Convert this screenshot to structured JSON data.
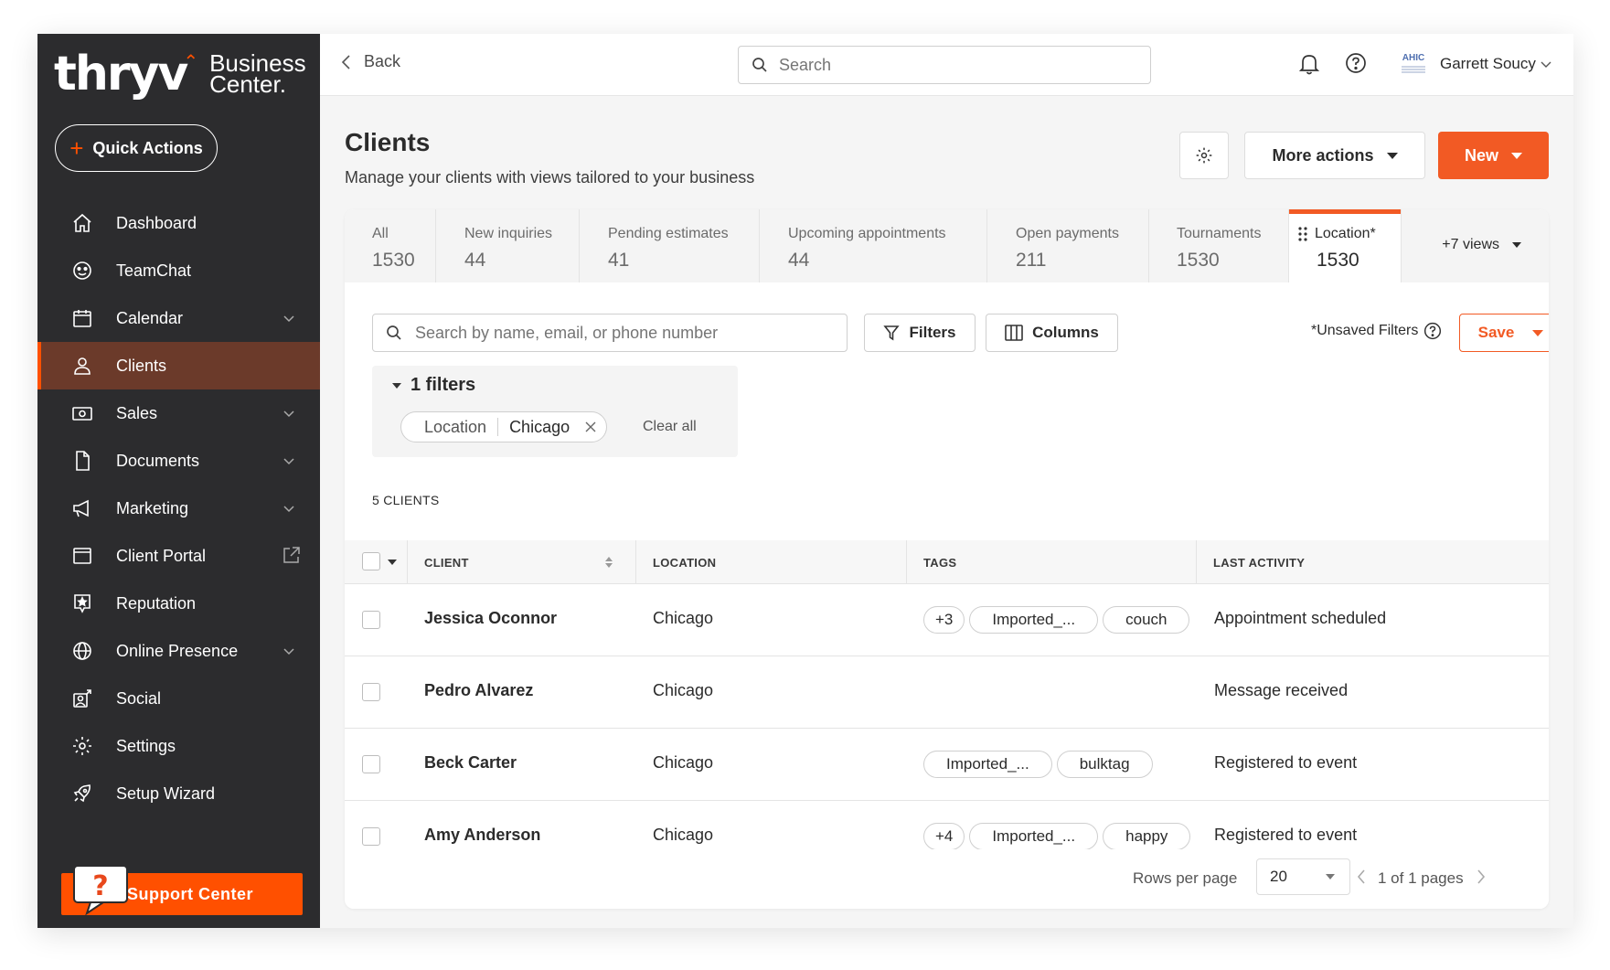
{
  "brand": {
    "logo_main": "thryv",
    "logo_sub_line1": "Business",
    "logo_sub_line2": "Center.",
    "accent": "#ff5000"
  },
  "sidebar": {
    "quick_actions": "Quick Actions",
    "items": [
      {
        "label": "Dashboard",
        "icon": "home-icon",
        "caret": false
      },
      {
        "label": "TeamChat",
        "icon": "chat-icon",
        "caret": false
      },
      {
        "label": "Calendar",
        "icon": "calendar-icon",
        "caret": true
      },
      {
        "label": "Clients",
        "icon": "person-icon",
        "caret": false,
        "active": true
      },
      {
        "label": "Sales",
        "icon": "money-icon",
        "caret": true
      },
      {
        "label": "Documents",
        "icon": "document-icon",
        "caret": true
      },
      {
        "label": "Marketing",
        "icon": "megaphone-icon",
        "caret": true
      },
      {
        "label": "Client Portal",
        "icon": "browser-icon",
        "caret": false,
        "external": true
      },
      {
        "label": "Reputation",
        "icon": "star-badge-icon",
        "caret": false
      },
      {
        "label": "Online Presence",
        "icon": "globe-icon",
        "caret": true
      },
      {
        "label": "Social",
        "icon": "social-icon",
        "caret": false
      },
      {
        "label": "Settings",
        "icon": "gear-icon",
        "caret": false
      },
      {
        "label": "Setup Wizard",
        "icon": "rocket-icon",
        "caret": false
      }
    ],
    "support": "Support Center"
  },
  "topbar": {
    "back": "Back",
    "search_placeholder": "Search",
    "avatar_text": "AHIC",
    "user_name": "Garrett Soucy"
  },
  "page": {
    "title": "Clients",
    "subtitle": "Manage your clients with views tailored to your business",
    "more_actions": "More actions",
    "new": "New"
  },
  "tabs": [
    {
      "label": "All",
      "count": "1530"
    },
    {
      "label": "New inquiries",
      "count": "44"
    },
    {
      "label": "Pending estimates",
      "count": "41"
    },
    {
      "label": "Upcoming appointments",
      "count": "44"
    },
    {
      "label": "Open payments",
      "count": "211"
    },
    {
      "label": "Tournaments",
      "count": "1530"
    },
    {
      "label": "Location*",
      "count": "1530",
      "active": true
    }
  ],
  "more_views": "+7 views",
  "toolbar": {
    "search_placeholder": "Search by name, email, or phone number",
    "filters": "Filters",
    "columns": "Columns",
    "unsaved": "*Unsaved Filters",
    "save": "Save"
  },
  "filters": {
    "heading": "1 filters",
    "chip_key": "Location",
    "chip_value": "Chicago",
    "clear_all": "Clear all"
  },
  "count_label": "5 CLIENTS",
  "table": {
    "headers": {
      "client": "CLIENT",
      "location": "LOCATION",
      "tags": "TAGS",
      "last_activity": "LAST ACTIVITY"
    },
    "rows": [
      {
        "name": "Jessica Oconnor",
        "location": "Chicago",
        "tags": [
          "+3",
          "Imported_...",
          "couch"
        ],
        "activity": "Appointment scheduled"
      },
      {
        "name": "Pedro Alvarez",
        "location": "Chicago",
        "tags": [],
        "activity": "Message received"
      },
      {
        "name": "Beck Carter",
        "location": "Chicago",
        "tags": [
          "Imported_...",
          "bulktag"
        ],
        "activity": "Registered to event"
      },
      {
        "name": "Amy Anderson",
        "location": "Chicago",
        "tags": [
          "+4",
          "Imported_...",
          "happy"
        ],
        "activity": "Registered to event"
      }
    ]
  },
  "pager": {
    "rows_label": "Rows per page",
    "rows_value": "20",
    "page_info": "1 of 1 pages"
  }
}
